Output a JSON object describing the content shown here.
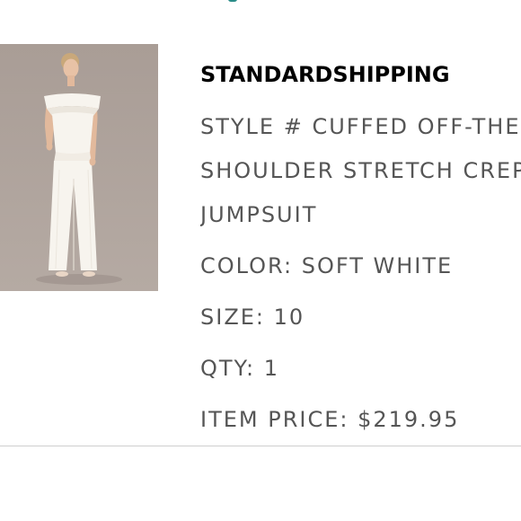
{
  "order_item": {
    "shipping_title": "STANDARDSHIPPING",
    "style_lines": [
      "STYLE # CUFFED OFF-THE-",
      "SHOULDER STRETCH CREPE",
      "JUMPSUIT"
    ],
    "color": "COLOR: SOFT WHITE",
    "size": "SIZE: 10",
    "qty": "QTY: 1",
    "item_price": "ITEM PRICE: $219.95"
  },
  "colors": {
    "image_background": "#ab9f98",
    "jumpsuit": "#f7f4ee",
    "title_text": "#000000",
    "detail_text": "#555555",
    "divider": "#cfcfcf",
    "accent_fragment": "#2a8c88"
  }
}
